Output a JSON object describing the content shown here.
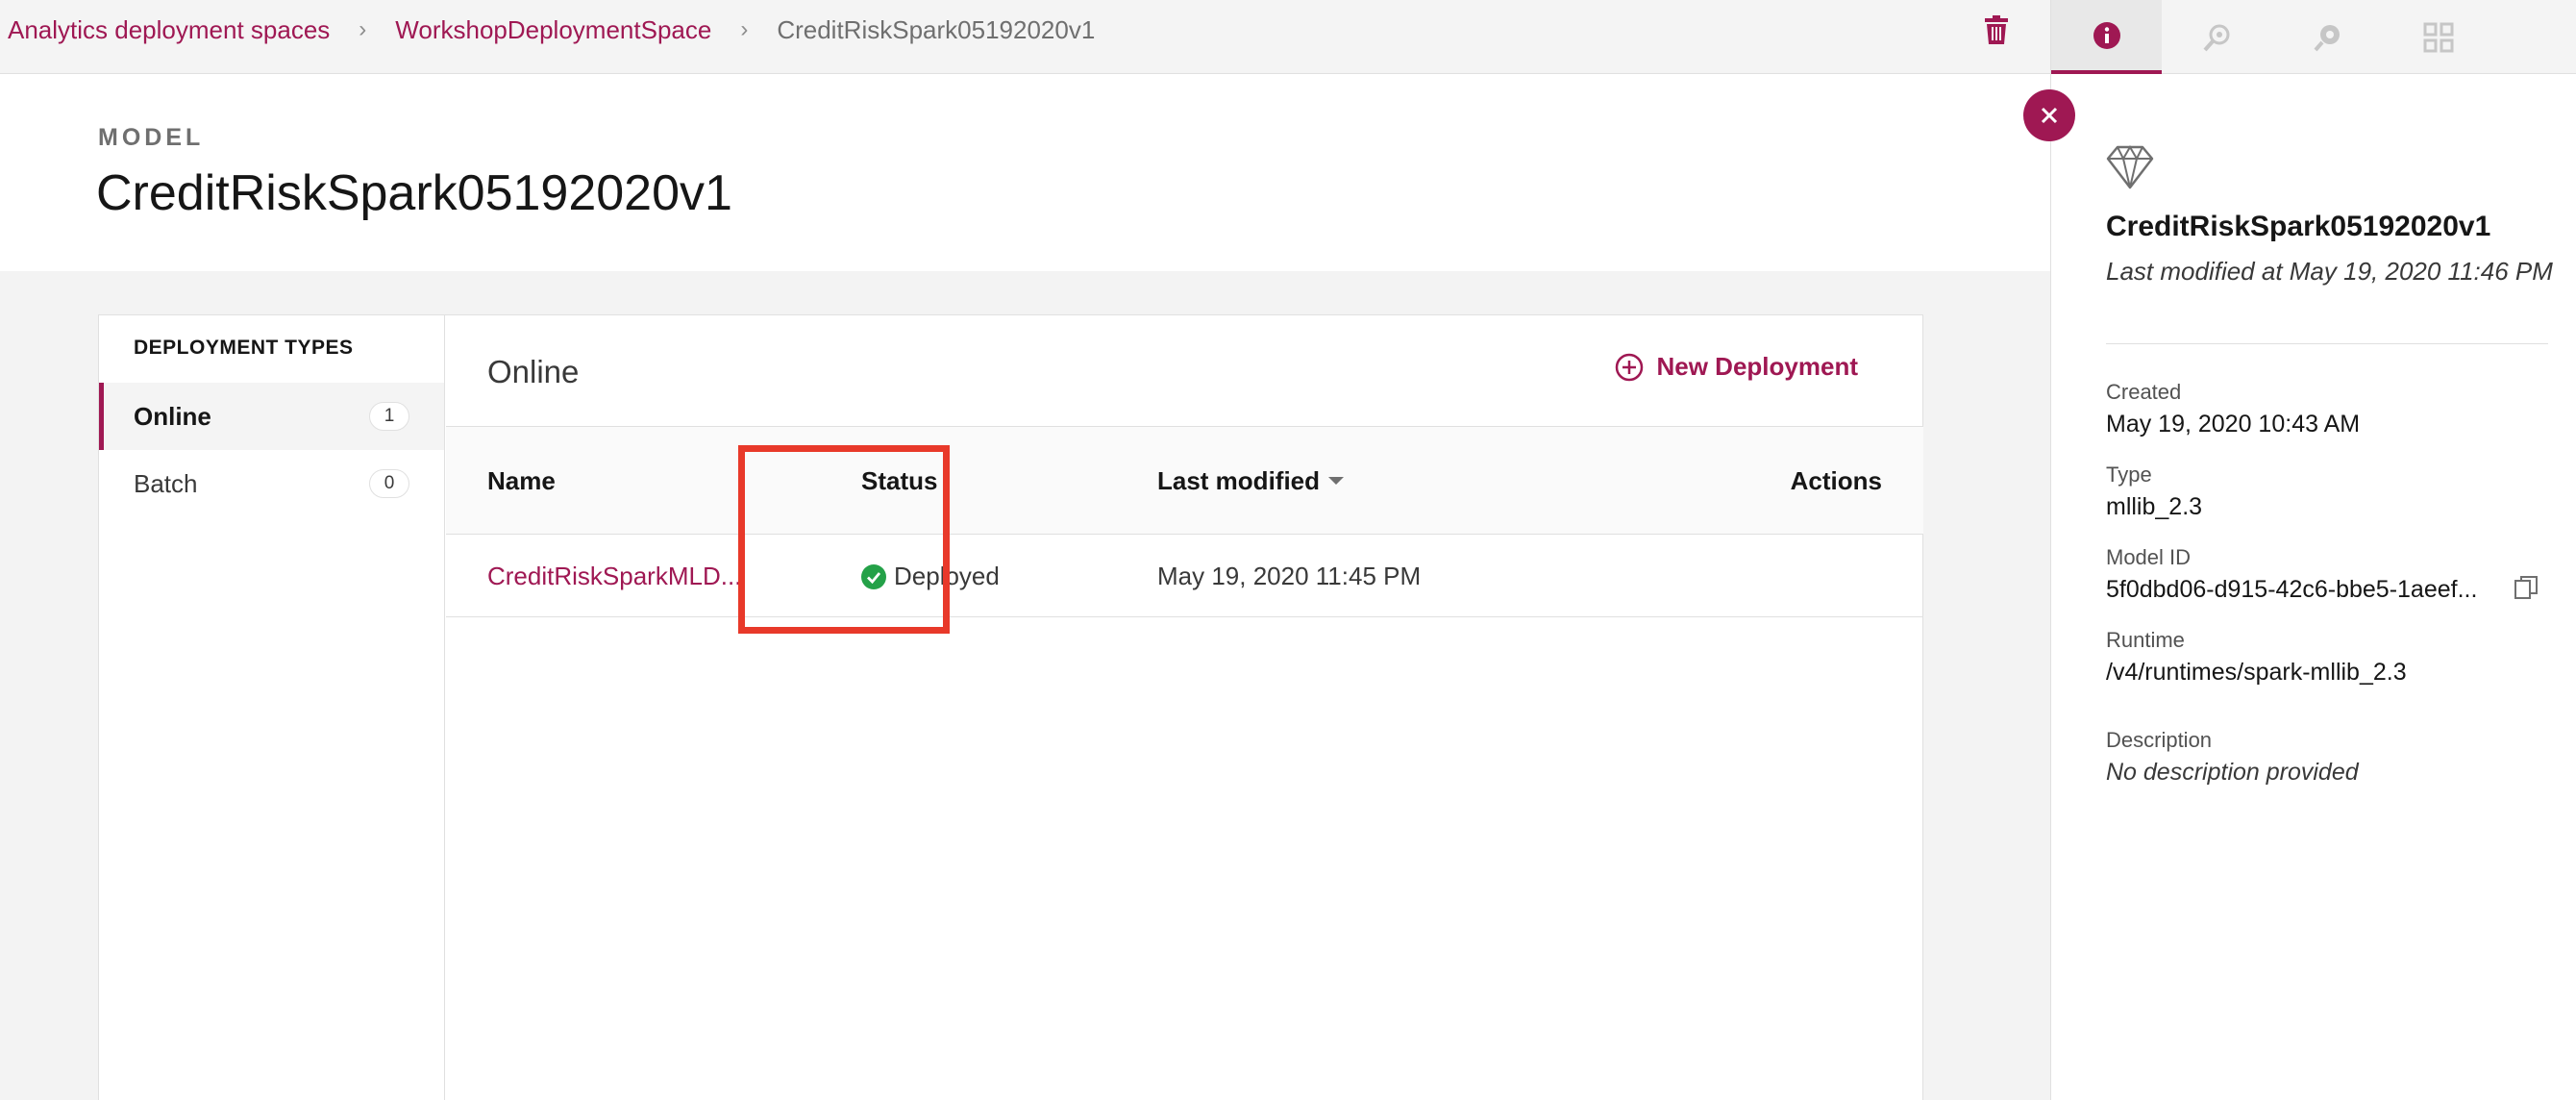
{
  "breadcrumb": {
    "items": [
      {
        "label": "Analytics deployment spaces"
      },
      {
        "label": "WorkshopDeploymentSpace"
      },
      {
        "label": "CreditRiskSpark05192020v1"
      }
    ]
  },
  "header": {
    "eyebrow": "MODEL",
    "title": "CreditRiskSpark05192020v1"
  },
  "icons": {
    "trash": "trash-icon",
    "info": "info-icon",
    "close": "close-icon",
    "model": "diamond-icon",
    "copy": "copy-icon",
    "status_ok": "check-circle-icon"
  },
  "colors": {
    "accent": "#9f1853",
    "success": "#24a148",
    "highlight": "#e8392a"
  },
  "deployment_types": {
    "title": "DEPLOYMENT TYPES",
    "items": [
      {
        "label": "Online",
        "count": "1"
      },
      {
        "label": "Batch",
        "count": "0"
      }
    ]
  },
  "main": {
    "title": "Online",
    "new_deployment_label": "New Deployment",
    "columns": {
      "name": "Name",
      "status": "Status",
      "last_modified": "Last modified",
      "actions": "Actions"
    },
    "rows": [
      {
        "name": "CreditRiskSparkMLD...",
        "status": "Deployed",
        "last_modified": "May 19, 2020 11:45 PM"
      }
    ]
  },
  "side_panel": {
    "name": "CreditRiskSpark05192020v1",
    "last_modified": "Last modified at May 19, 2020 11:46 PM",
    "created_label": "Created",
    "created_value": "May 19, 2020 10:43 AM",
    "type_label": "Type",
    "type_value": "mllib_2.3",
    "model_id_label": "Model ID",
    "model_id_value": "5f0dbd06-d915-42c6-bbe5-1aeef...",
    "runtime_label": "Runtime",
    "runtime_value": "/v4/runtimes/spark-mllib_2.3",
    "description_label": "Description",
    "description_value": "No description provided"
  }
}
